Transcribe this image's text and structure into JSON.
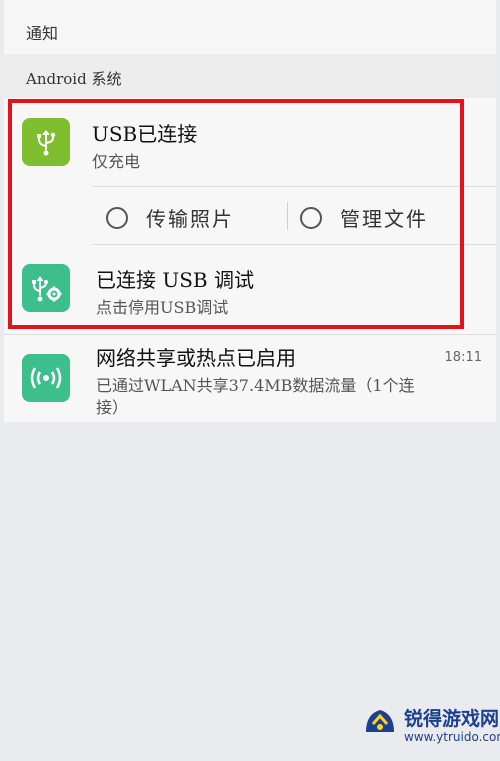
{
  "header": {
    "title": "通知"
  },
  "section": {
    "label": "Android 系统"
  },
  "notifications": [
    {
      "title": "USB已连接",
      "subtitle": "仅充电",
      "icon": "usb-icon",
      "color": "#7fbf2f"
    },
    {
      "title": "已连接 USB 调试",
      "subtitle": "点击停用USB调试",
      "icon": "usb-debug-icon",
      "color": "#3cbf8c"
    },
    {
      "title": "网络共享或热点已启用",
      "subtitle_line1": "已通过WLAN共享37.4MB数据流量（1个连",
      "subtitle_line2": "接）",
      "time": "18:11",
      "icon": "hotspot-icon",
      "color": "#3cbf8c"
    }
  ],
  "actions": [
    {
      "label": "传输照片"
    },
    {
      "label": "管理文件"
    }
  ],
  "watermark": {
    "name": "锐得游戏网",
    "url": "www.ytruido.com"
  },
  "colors": {
    "highlight": "#e4131b",
    "usb_green": "#7fbf2f",
    "teal": "#3cbf8c"
  }
}
